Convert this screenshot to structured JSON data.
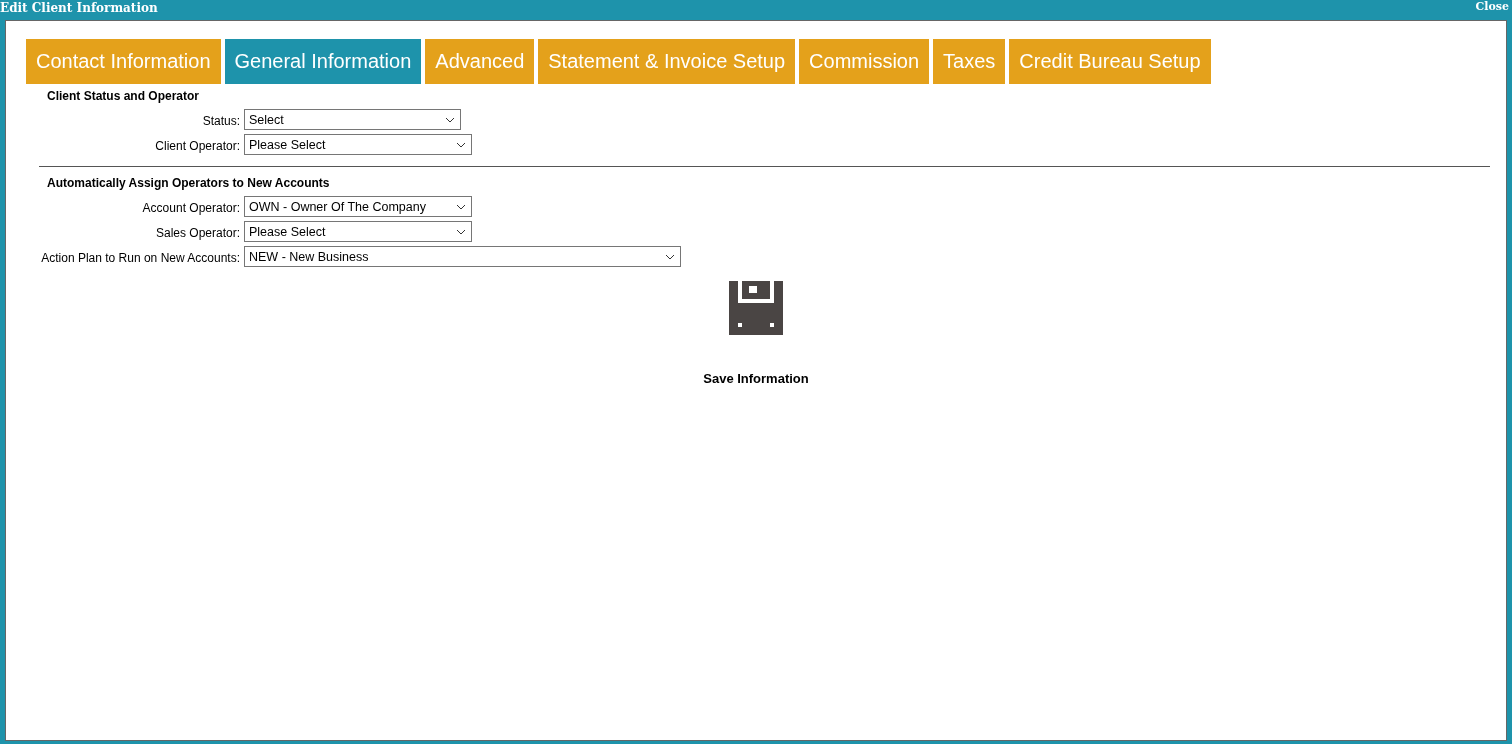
{
  "window": {
    "title": "Edit Client Information",
    "close": "Close"
  },
  "tabs": [
    {
      "label": "Contact Information",
      "selected": false
    },
    {
      "label": "General Information",
      "selected": true
    },
    {
      "label": "Advanced",
      "selected": false
    },
    {
      "label": "Statement & Invoice Setup",
      "selected": false
    },
    {
      "label": "Commission",
      "selected": false
    },
    {
      "label": "Taxes",
      "selected": false
    },
    {
      "label": "Credit Bureau Setup",
      "selected": false
    }
  ],
  "sections": [
    {
      "title": "Client Status and Operator",
      "fields": [
        {
          "label": "Status:",
          "value": "Select"
        },
        {
          "label": "Client Operator:",
          "value": "Please Select"
        }
      ]
    },
    {
      "title": "Automatically Assign Operators to New Accounts",
      "fields": [
        {
          "label": "Account Operator:",
          "value": "OWN - Owner Of The Company"
        },
        {
          "label": "Sales Operator:",
          "value": "Please Select"
        },
        {
          "label": "Action Plan to Run on New Accounts:",
          "value": "NEW - New Business"
        }
      ]
    }
  ],
  "save_button": {
    "label": "Save Information"
  }
}
